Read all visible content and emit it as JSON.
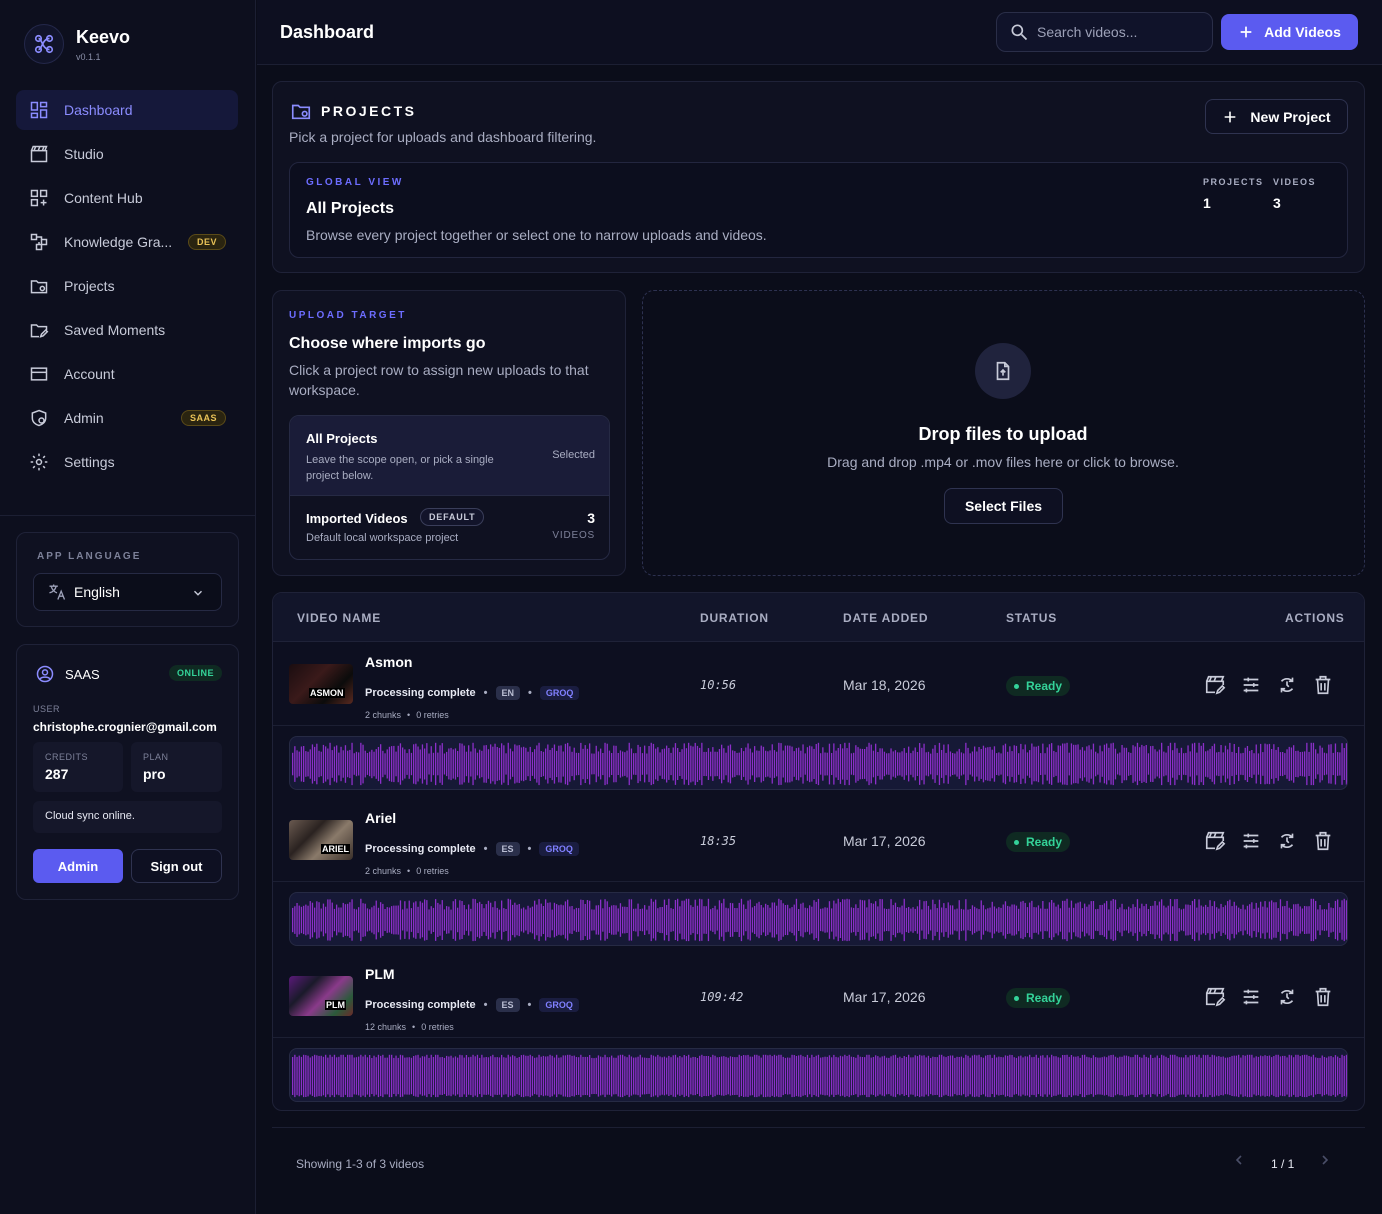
{
  "app": {
    "name": "Keevo",
    "version": "v0.1.1"
  },
  "sidebar": {
    "items": [
      {
        "label": "Dashboard",
        "icon": "dashboard-icon",
        "active": true
      },
      {
        "label": "Studio",
        "icon": "clapper-icon"
      },
      {
        "label": "Content Hub",
        "icon": "grid-plus-icon"
      },
      {
        "label": "Knowledge Gra...",
        "icon": "graph-icon",
        "badge": "DEV"
      },
      {
        "label": "Projects",
        "icon": "folder-gear-icon"
      },
      {
        "label": "Saved Moments",
        "icon": "folder-edit-icon"
      },
      {
        "label": "Account",
        "icon": "card-icon"
      },
      {
        "label": "Admin",
        "icon": "shield-user-icon",
        "badge": "SAAS"
      },
      {
        "label": "Settings",
        "icon": "gear-icon"
      }
    ]
  },
  "language": {
    "label": "APP LANGUAGE",
    "value": "English"
  },
  "account": {
    "tier": "SAAS",
    "status": "ONLINE",
    "user_label": "USER",
    "email": "christophe.crognier@gmail.com",
    "credits_label": "CREDITS",
    "credits": "287",
    "plan_label": "PLAN",
    "plan": "pro",
    "sync": "Cloud sync online.",
    "admin_btn": "Admin",
    "signout_btn": "Sign out"
  },
  "header": {
    "title": "Dashboard",
    "search_placeholder": "Search videos...",
    "add_btn": "Add Videos"
  },
  "projects": {
    "title": "PROJECTS",
    "subtitle": "Pick a project for uploads and dashboard filtering.",
    "new_btn": "New Project",
    "global": {
      "kicker": "GLOBAL VIEW",
      "title": "All Projects",
      "desc": "Browse every project together or select one to narrow uploads and videos.",
      "projects_label": "PROJECTS",
      "projects_count": "1",
      "videos_label": "VIDEOS",
      "videos_count": "3"
    }
  },
  "upload": {
    "kicker": "UPLOAD TARGET",
    "title": "Choose where imports go",
    "desc": "Click a project row to assign new uploads to that workspace.",
    "all": {
      "title": "All Projects",
      "desc": "Leave the scope open, or pick a single project below.",
      "state": "Selected"
    },
    "imported": {
      "title": "Imported Videos",
      "badge": "DEFAULT",
      "desc": "Default local workspace project",
      "count": "3",
      "count_label": "VIDEOS"
    }
  },
  "drop": {
    "title": "Drop files to upload",
    "desc": "Drag and drop .mp4 or .mov files here or click to browse.",
    "btn": "Select Files"
  },
  "table": {
    "headers": {
      "name": "VIDEO NAME",
      "duration": "DURATION",
      "date": "DATE ADDED",
      "status": "STATUS",
      "actions": "ACTIONS"
    },
    "rows": [
      {
        "name": "Asmon",
        "thumb_label": "ASMON",
        "status_text": "Processing complete",
        "lang": "EN",
        "engine": "GROQ",
        "chunks": "2 chunks",
        "retries": "0 retries",
        "duration": "10:56",
        "date": "Mar 18, 2026",
        "state": "Ready"
      },
      {
        "name": "Ariel",
        "thumb_label": "ARIEL",
        "status_text": "Processing complete",
        "lang": "ES",
        "engine": "GROQ",
        "chunks": "2 chunks",
        "retries": "0 retries",
        "duration": "18:35",
        "date": "Mar 17, 2026",
        "state": "Ready"
      },
      {
        "name": "PLM",
        "thumb_label": "PLM",
        "status_text": "Processing complete",
        "lang": "ES",
        "engine": "GROQ",
        "chunks": "12 chunks",
        "retries": "0 retries",
        "duration": "109:42",
        "date": "Mar 17, 2026",
        "state": "Ready"
      }
    ]
  },
  "footer": {
    "showing": "Showing 1-3 of 3 videos",
    "page": "1 / 1"
  },
  "colors": {
    "accent": "#5b5bf0",
    "ready": "#34d399",
    "wave": "#8b2fc9"
  }
}
